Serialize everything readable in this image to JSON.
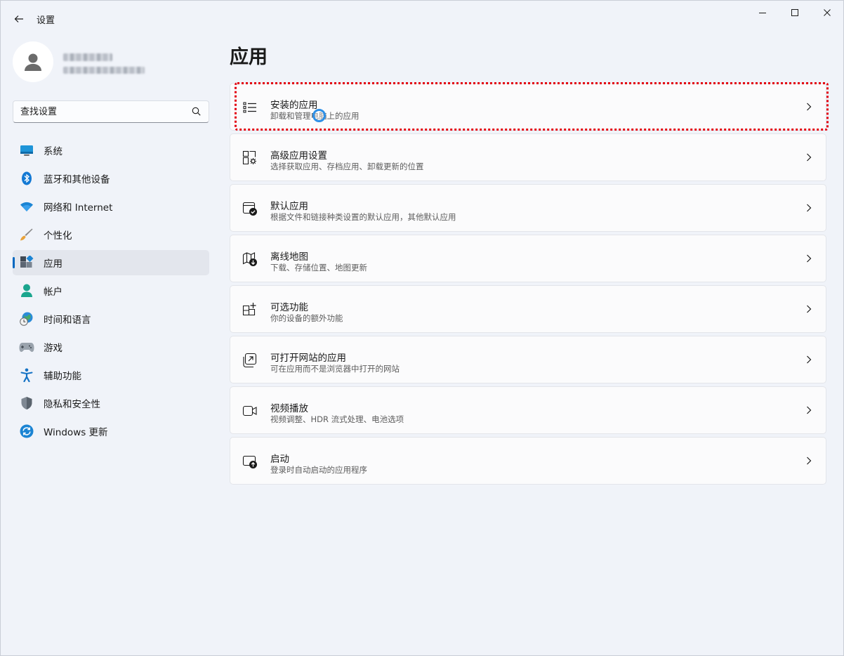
{
  "window": {
    "title": "设置"
  },
  "user": {
    "name_redacted": true,
    "email_redacted": true
  },
  "search": {
    "placeholder": "查找设置"
  },
  "sidebar": {
    "items": [
      {
        "label": "系统",
        "icon": "system-display-icon",
        "active": false
      },
      {
        "label": "蓝牙和其他设备",
        "icon": "bluetooth-icon",
        "active": false
      },
      {
        "label": "网络和 Internet",
        "icon": "wifi-icon",
        "active": false
      },
      {
        "label": "个性化",
        "icon": "paintbrush-icon",
        "active": false
      },
      {
        "label": "应用",
        "icon": "apps-icon",
        "active": true
      },
      {
        "label": "帐户",
        "icon": "account-icon",
        "active": false
      },
      {
        "label": "时间和语言",
        "icon": "time-language-icon",
        "active": false
      },
      {
        "label": "游戏",
        "icon": "gamepad-icon",
        "active": false
      },
      {
        "label": "辅助功能",
        "icon": "accessibility-icon",
        "active": false
      },
      {
        "label": "隐私和安全性",
        "icon": "shield-icon",
        "active": false
      },
      {
        "label": "Windows 更新",
        "icon": "windows-update-icon",
        "active": false
      }
    ]
  },
  "main": {
    "title": "应用",
    "cards": [
      {
        "title": "安装的应用",
        "subtitle": "卸载和管理电脑上的应用",
        "icon": "installed-apps-list-icon"
      },
      {
        "title": "高级应用设置",
        "subtitle": "选择获取应用、存档应用、卸载更新的位置",
        "icon": "advanced-app-settings-icon"
      },
      {
        "title": "默认应用",
        "subtitle": "根据文件和链接种类设置的默认应用，其他默认应用",
        "icon": "default-apps-icon"
      },
      {
        "title": "离线地图",
        "subtitle": "下载、存储位置、地图更新",
        "icon": "offline-maps-icon"
      },
      {
        "title": "可选功能",
        "subtitle": "你的设备的额外功能",
        "icon": "optional-features-icon"
      },
      {
        "title": "可打开网站的应用",
        "subtitle": "可在应用而不是浏览器中打开的网站",
        "icon": "apps-for-websites-icon"
      },
      {
        "title": "视频播放",
        "subtitle": "视频调整、HDR 流式处理、电池选项",
        "icon": "video-playback-icon"
      },
      {
        "title": "启动",
        "subtitle": "登录时自动启动的应用程序",
        "icon": "startup-icon"
      }
    ]
  },
  "colors": {
    "accent": "#0067c0",
    "highlight_border": "#e3000f",
    "cursor": "#2d8fe6"
  }
}
